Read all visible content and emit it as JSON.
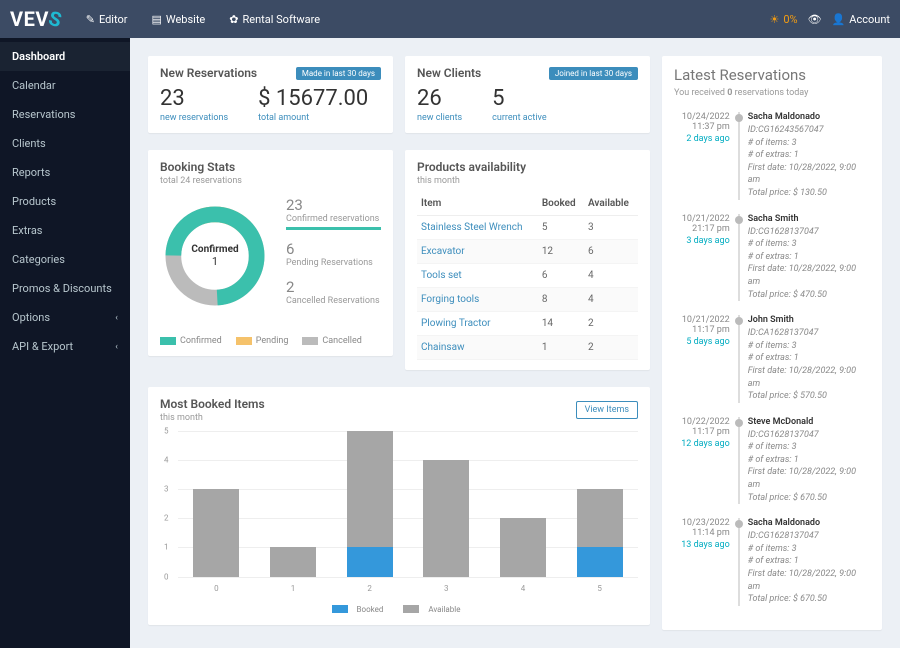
{
  "brand": "VEVS",
  "topnav": {
    "editor": "Editor",
    "website": "Website",
    "rental": "Rental Software"
  },
  "topright": {
    "pct": "0%",
    "account": "Account"
  },
  "sidebar": {
    "items": [
      {
        "label": "Dashboard",
        "active": true
      },
      {
        "label": "Calendar"
      },
      {
        "label": "Reservations"
      },
      {
        "label": "Clients"
      },
      {
        "label": "Reports"
      },
      {
        "label": "Products"
      },
      {
        "label": "Extras"
      },
      {
        "label": "Categories"
      },
      {
        "label": "Promos & Discounts"
      },
      {
        "label": "Options",
        "caret": true
      },
      {
        "label": "API & Export",
        "caret": true
      }
    ]
  },
  "newres": {
    "title": "New Reservations",
    "badge": "Made in last 30 days",
    "v1": "23",
    "l1": "new reservations",
    "v2": "$ 15677.00",
    "l2": "total amount"
  },
  "newcli": {
    "title": "New Clients",
    "badge": "Joined in last 30 days",
    "v1": "26",
    "l1": "new clients",
    "v2": "5",
    "l2": "current active"
  },
  "latest": {
    "title": "Latest Reservations",
    "sub_pre": "You received ",
    "sub_n": "0",
    "sub_post": " reservations today",
    "items": [
      {
        "date": "10/24/2022",
        "time": "11:37 pm",
        "ago": "2 days ago",
        "name": "Sacha Maldonado",
        "id": "ID:CG16243567047",
        "items": "# of items: 3",
        "extras": "# of extras: 1",
        "first": "First date: 10/28/2022, 9:00 am",
        "price": "Total price: $ 130.50"
      },
      {
        "date": "10/21/2022",
        "time": "21:17 pm",
        "ago": "3 days ago",
        "name": "Sacha Smith",
        "id": "ID:CG1628137047",
        "items": "# of items: 3",
        "extras": "# of extras: 1",
        "first": "First date: 10/28/2022, 9:00 am",
        "price": "Total price: $ 470.50"
      },
      {
        "date": "10/21/2022",
        "time": "11:17 pm",
        "ago": "5 days ago",
        "name": "John Smith",
        "id": "ID:CA1628137047",
        "items": "# of items: 3",
        "extras": "# of extras: 1",
        "first": "First date: 10/28/2022, 9:00 am",
        "price": "Total price: $ 570.50"
      },
      {
        "date": "10/22/2022",
        "time": "11:17 pm",
        "ago": "12 days ago",
        "name": "Steve McDonald",
        "id": "ID:CG1628137047",
        "items": "# of items: 3",
        "extras": "# of extras: 1",
        "first": "First date: 10/28/2022, 9:00 am",
        "price": "Total price: $ 670.50"
      },
      {
        "date": "10/23/2022",
        "time": "11:14 pm",
        "ago": "13 days ago",
        "name": "Sacha Maldonado",
        "id": "ID:CG1628137047",
        "items": "# of items: 3",
        "extras": "# of extras: 1",
        "first": "First date: 10/28/2022, 9:00 am",
        "price": "Total price: $ 670.50"
      }
    ]
  },
  "booking": {
    "title": "Booking Stats",
    "sub": "total 24 reservations",
    "center_lbl": "Confirmed",
    "center_val": "1",
    "rows": [
      {
        "n": "23",
        "d": "Confirmed reservations",
        "conf": true
      },
      {
        "n": "6",
        "d": "Pending Reservations"
      },
      {
        "n": "2",
        "d": "Cancelled Reservations"
      }
    ],
    "legend": {
      "conf": "Confirmed",
      "pend": "Pending",
      "canc": "Cancelled"
    }
  },
  "products": {
    "title": "Products availability",
    "sub": "this month",
    "cols": {
      "item": "Item",
      "booked": "Booked",
      "avail": "Available"
    },
    "rows": [
      {
        "item": "Stainless Steel Wrench",
        "booked": "5",
        "avail": "3"
      },
      {
        "item": "Excavator",
        "booked": "12",
        "avail": "6"
      },
      {
        "item": "Tools set",
        "booked": "6",
        "avail": "4"
      },
      {
        "item": "Forging tools",
        "booked": "8",
        "avail": "4"
      },
      {
        "item": "Plowing Tractor",
        "booked": "14",
        "avail": "2"
      },
      {
        "item": "Chainsaw",
        "booked": "1",
        "avail": "2"
      }
    ]
  },
  "most": {
    "title": "Most Booked Items",
    "sub": "this month",
    "btn": "View Items",
    "legend": {
      "booked": "Booked",
      "avail": "Available"
    }
  },
  "chart_data": {
    "type": "bar",
    "categories": [
      "0",
      "1",
      "2",
      "3",
      "4",
      "5"
    ],
    "series": [
      {
        "name": "Booked",
        "values": [
          0,
          0,
          1,
          0,
          0,
          1
        ]
      },
      {
        "name": "Available",
        "values": [
          3,
          1,
          4,
          4,
          2,
          2
        ]
      }
    ],
    "ylim": [
      0,
      5
    ],
    "yticks": [
      0,
      1,
      2,
      3,
      4,
      5
    ]
  }
}
